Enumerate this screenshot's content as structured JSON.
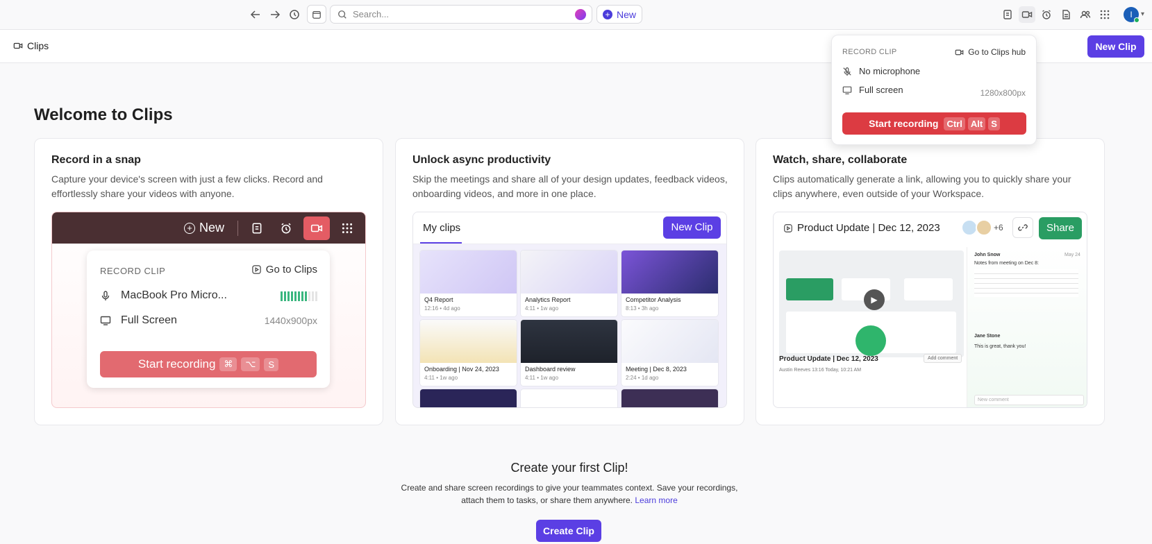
{
  "topbar": {
    "search_placeholder": "Search...",
    "new_label": "New"
  },
  "subheader": {
    "crumb": "Clips",
    "new_clip_label": "New Clip"
  },
  "welcome_title": "Welcome to Clips",
  "cards": [
    {
      "title": "Record in a snap",
      "desc": "Capture your device's screen with just a few clicks. Record and effortlessly share your videos with anyone.",
      "ill": {
        "new_label": "New",
        "record_label": "RECORD CLIP",
        "goto_label": "Go to Clips",
        "mic_label": "MacBook Pro Micro...",
        "screen_label": "Full Screen",
        "resolution": "1440x900px",
        "start_label": "Start recording",
        "keys": [
          "⌘",
          "⌥",
          "S"
        ]
      }
    },
    {
      "title": "Unlock async productivity",
      "desc": "Skip the meetings and share all of your design updates, feedback videos, onboarding videos, and more in one place.",
      "ill": {
        "tab_label": "My clips",
        "new_clip_label": "New Clip",
        "thumbs": [
          {
            "title": "Q4 Report",
            "meta": "12:16 • 4d ago"
          },
          {
            "title": "Analytics Report",
            "meta": "4:11 • 1w ago"
          },
          {
            "title": "Competitor Analysis",
            "meta": "8:13 • 3h ago"
          },
          {
            "title": "Onboarding | Nov 24, 2023",
            "meta": "4:11 • 1w ago"
          },
          {
            "title": "Dashboard review",
            "meta": "4:11 • 1w ago"
          },
          {
            "title": "Meeting | Dec 8, 2023",
            "meta": "2:24 • 1d ago"
          }
        ]
      }
    },
    {
      "title": "Watch, share, collaborate",
      "desc": "Clips automatically generate a link, allowing you to quickly share your clips anywhere, even outside of your Workspace.",
      "ill": {
        "video_title": "Product Update | Dec 12, 2023",
        "plus_count": "+6",
        "share_label": "Share",
        "caption_title": "Product Update | Dec 12, 2023",
        "caption_meta": "Austin Reeves   13:16   Today, 10:21 AM",
        "add_comment": "Add comment",
        "comment_author": "John Snow",
        "comment_time": "May 24",
        "comment_text": "Notes from meeting on Dec 8:",
        "reply_author": "Jane Stone",
        "reply_text": "This is great, thank you!",
        "new_comment": "New comment"
      }
    }
  ],
  "cta": {
    "title": "Create your first Clip!",
    "desc": "Create and share screen recordings to give your teammates context. Save your recordings, attach them to tasks, or share them anywhere.",
    "learn_more": "Learn more",
    "button": "Create Clip"
  },
  "popover": {
    "record_label": "RECORD CLIP",
    "goto_label": "Go to Clips hub",
    "mic_label": "No microphone",
    "screen_label": "Full screen",
    "resolution": "1280x800px",
    "start_label": "Start recording",
    "keys": [
      "Ctrl",
      "Alt",
      "S"
    ]
  },
  "colors": {
    "accent": "#5b3fe4",
    "record_red": "#dc3b42",
    "share_green": "#2a9d63"
  }
}
